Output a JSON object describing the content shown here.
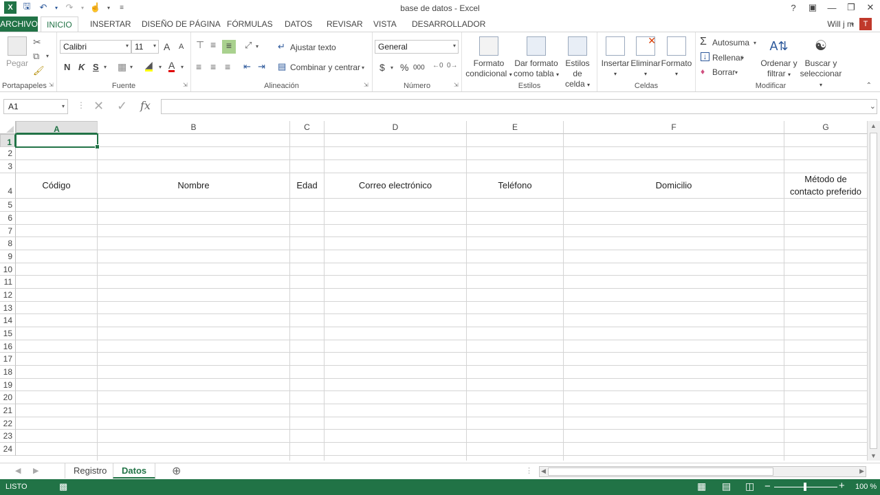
{
  "window": {
    "title": "base de datos - Excel",
    "help": "?",
    "user": "Will j m",
    "user_initial": "T"
  },
  "ribbon_tabs": [
    "ARCHIVO",
    "INICIO",
    "INSERTAR",
    "DISEÑO DE PÁGINA",
    "FÓRMULAS",
    "DATOS",
    "REVISAR",
    "VISTA",
    "DESARROLLADOR"
  ],
  "ribbon": {
    "clipboard": {
      "label": "Portapapeles",
      "paste": "Pegar"
    },
    "font": {
      "label": "Fuente",
      "name": "Calibri",
      "size": "11",
      "bold": "N",
      "italic": "K",
      "underline": "S",
      "grow": "A",
      "shrink": "A"
    },
    "alignment": {
      "label": "Alineación",
      "wrap": "Ajustar texto",
      "merge": "Combinar y centrar"
    },
    "number": {
      "label": "Número",
      "format": "General",
      "currency": "$",
      "percent": "%",
      "thousands": "000"
    },
    "styles": {
      "label": "Estilos",
      "cond1": "Formato",
      "cond2": "condicional",
      "table1": "Dar formato",
      "table2": "como tabla",
      "cell1": "Estilos de",
      "cell2": "celda"
    },
    "cells": {
      "label": "Celdas",
      "insert": "Insertar",
      "delete": "Eliminar",
      "format": "Formato"
    },
    "editing": {
      "label": "Modificar",
      "autosum": "Autosuma",
      "fill": "Rellenar",
      "clear": "Borrar",
      "sort1": "Ordenar y",
      "sort2": "filtrar",
      "find1": "Buscar y",
      "find2": "seleccionar"
    }
  },
  "formula_bar": {
    "name_box": "A1",
    "fx": "fx",
    "value": ""
  },
  "columns": [
    "A",
    "B",
    "C",
    "D",
    "E",
    "F",
    "G"
  ],
  "rows": [
    "1",
    "2",
    "3",
    "4",
    "5",
    "6",
    "7",
    "8",
    "9",
    "10",
    "11",
    "12",
    "13",
    "14",
    "15",
    "16",
    "17",
    "18",
    "19",
    "20",
    "21",
    "22",
    "23",
    "24"
  ],
  "headers_row4": {
    "A": "Código",
    "B": "Nombre",
    "C": "Edad",
    "D": "Correo electrónico",
    "E": "Teléfono",
    "F": "Domicilio",
    "G1": "Método de",
    "G2": "contacto preferido"
  },
  "sheets": [
    "Registro",
    "Datos"
  ],
  "active_sheet": "Datos",
  "status": {
    "mode": "LISTO",
    "zoom": "100 %"
  },
  "colors": {
    "accent": "#217346"
  }
}
